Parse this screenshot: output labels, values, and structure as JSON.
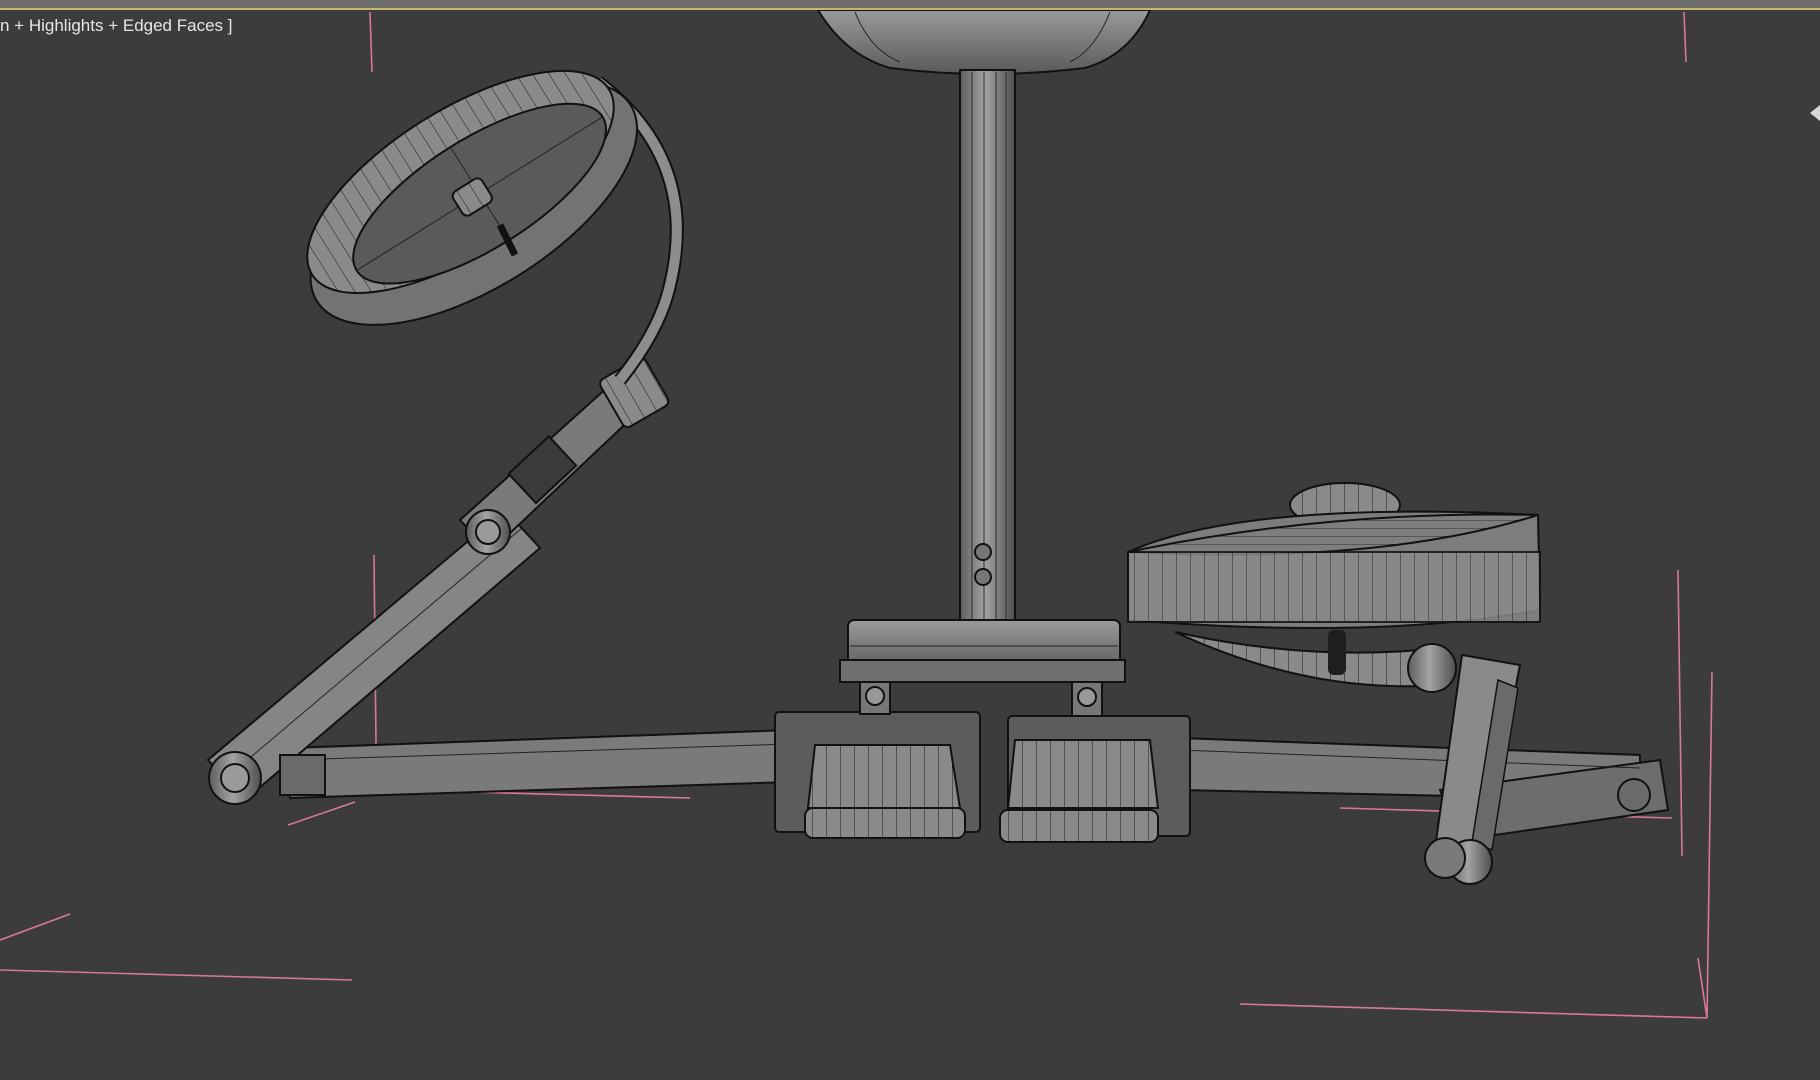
{
  "viewport": {
    "shading_label": "n + Highlights + Edged Faces ]",
    "background_color": "#3c3c3c",
    "bounding_box_color": "#e07aa0",
    "mesh_fill_color": "#8c8c8c",
    "mesh_edge_color": "#111111"
  },
  "scene": {
    "object": "surgical-lamp-model",
    "components": [
      "ceiling-cup",
      "central-pole",
      "pole-collar",
      "pole-base",
      "counterweight-left",
      "counterweight-right",
      "arm-left",
      "arm-right",
      "lamp-head-left",
      "lamp-head-right",
      "elbow-joint-left",
      "elbow-joint-right"
    ]
  }
}
